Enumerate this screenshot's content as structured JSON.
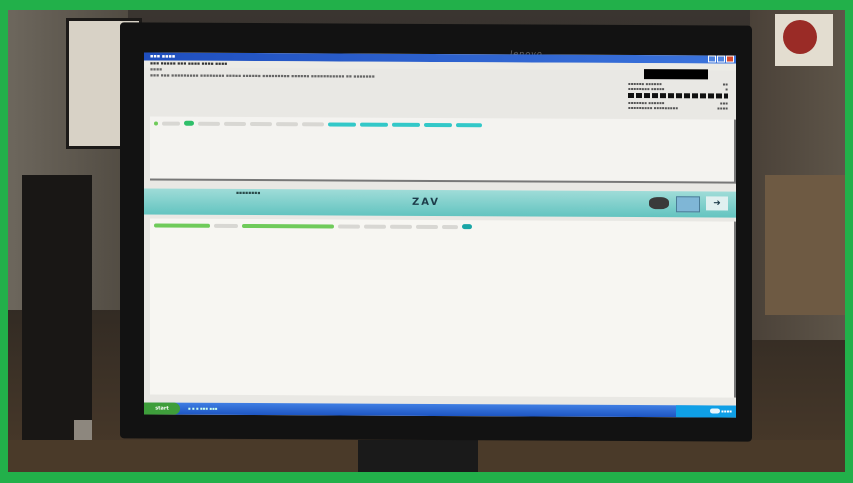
{
  "monitor": {
    "brand": "lenovo"
  },
  "app": {
    "title": "ZAV",
    "window_controls": [
      "minimize",
      "maximize",
      "close"
    ]
  },
  "taskbar": {
    "start_label": "start"
  },
  "icons": [
    "network-card-icon",
    "keyboard-icon",
    "arrow-right-icon"
  ],
  "colors": {
    "frame_border": "#22b04a",
    "ribbon": "#63c4c0",
    "screen_bg": "#e9e8e4",
    "titlebar": "#1f4fbf",
    "taskbar": "#1d55c2",
    "start_button": "#3e9e3b",
    "chip_green": "#6fcb5a",
    "chip_teal": "#33c8c8"
  }
}
